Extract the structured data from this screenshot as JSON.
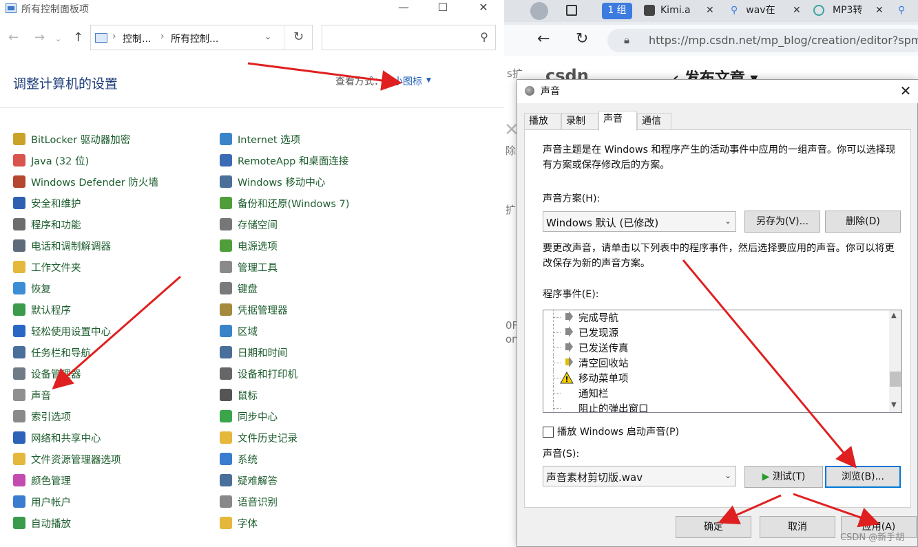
{
  "control_panel": {
    "window_title": "所有控制面板项",
    "window_buttons": [
      "—",
      "☐",
      "✕"
    ],
    "breadcrumb": [
      "控制...",
      "所有控制..."
    ],
    "search_placeholder": "",
    "heading": "调整计算机的设置",
    "view_by_label": "查看方式：",
    "view_by_value": "小图标",
    "items_left": [
      {
        "label": "BitLocker 驱动器加密",
        "icon": "bitlocker-icon",
        "color": "#c9a227"
      },
      {
        "label": "Java (32 位)",
        "icon": "java-icon",
        "color": "#d9534f"
      },
      {
        "label": "Windows Defender 防火墙",
        "icon": "firewall-icon",
        "color": "#b5462f"
      },
      {
        "label": "安全和维护",
        "icon": "flag-icon",
        "color": "#2f5fb3"
      },
      {
        "label": "程序和功能",
        "icon": "programs-icon",
        "color": "#6d6d6d"
      },
      {
        "label": "电话和调制解调器",
        "icon": "phone-icon",
        "color": "#5e6b7a"
      },
      {
        "label": "工作文件夹",
        "icon": "work-folder-icon",
        "color": "#e5b73b"
      },
      {
        "label": "恢复",
        "icon": "recovery-icon",
        "color": "#3b8ed6"
      },
      {
        "label": "默认程序",
        "icon": "default-programs-icon",
        "color": "#3a9b4c"
      },
      {
        "label": "轻松使用设置中心",
        "icon": "accessibility-icon",
        "color": "#2a67c4"
      },
      {
        "label": "任务栏和导航",
        "icon": "taskbar-icon",
        "color": "#4a6f9a"
      },
      {
        "label": "设备管理器",
        "icon": "device-manager-icon",
        "color": "#6f7b86"
      },
      {
        "label": "声音",
        "icon": "sound-icon",
        "color": "#8f8f8f"
      },
      {
        "label": "索引选项",
        "icon": "index-icon",
        "color": "#8a8a8a"
      },
      {
        "label": "网络和共享中心",
        "icon": "network-icon",
        "color": "#2c62b8"
      },
      {
        "label": "文件资源管理器选项",
        "icon": "folder-options-icon",
        "color": "#e5b73b"
      },
      {
        "label": "颜色管理",
        "icon": "color-icon",
        "color": "#c44bb0"
      },
      {
        "label": "用户帐户",
        "icon": "user-accounts-icon",
        "color": "#3a7ccf"
      },
      {
        "label": "自动播放",
        "icon": "autoplay-icon",
        "color": "#3a9b4c"
      }
    ],
    "items_right": [
      {
        "label": "Internet 选项",
        "icon": "internet-icon",
        "color": "#3a85c9"
      },
      {
        "label": "RemoteApp 和桌面连接",
        "icon": "remoteapp-icon",
        "color": "#3b6bb5"
      },
      {
        "label": "Windows 移动中心",
        "icon": "mobility-icon",
        "color": "#4a6f9a"
      },
      {
        "label": "备份和还原(Windows 7)",
        "icon": "backup-icon",
        "color": "#4f9e3a"
      },
      {
        "label": "存储空间",
        "icon": "storage-icon",
        "color": "#777777"
      },
      {
        "label": "电源选项",
        "icon": "power-icon",
        "color": "#4f9e3a"
      },
      {
        "label": "管理工具",
        "icon": "admin-tools-icon",
        "color": "#8a8a8a"
      },
      {
        "label": "键盘",
        "icon": "keyboard-icon",
        "color": "#7a7a7a"
      },
      {
        "label": "凭据管理器",
        "icon": "credential-icon",
        "color": "#a58a3e"
      },
      {
        "label": "区域",
        "icon": "region-icon",
        "color": "#3a85c9"
      },
      {
        "label": "日期和时间",
        "icon": "clock-icon",
        "color": "#4a6f9a"
      },
      {
        "label": "设备和打印机",
        "icon": "printer-icon",
        "color": "#666666"
      },
      {
        "label": "鼠标",
        "icon": "mouse-icon",
        "color": "#555555"
      },
      {
        "label": "同步中心",
        "icon": "sync-icon",
        "color": "#3aa54a"
      },
      {
        "label": "文件历史记录",
        "icon": "file-history-icon",
        "color": "#e5b73b"
      },
      {
        "label": "系统",
        "icon": "system-icon",
        "color": "#3a7ccf"
      },
      {
        "label": "疑难解答",
        "icon": "troubleshoot-icon",
        "color": "#4a6f9a"
      },
      {
        "label": "语音识别",
        "icon": "mic-icon",
        "color": "#888888"
      },
      {
        "label": "字体",
        "icon": "font-icon",
        "color": "#e5b73b"
      }
    ]
  },
  "browser": {
    "tabs": [
      "1 组",
      "Kimi.a",
      "wav在",
      "MP3转"
    ],
    "url": "https://mp.csdn.net/mp_blog/creation/editor?spm=",
    "page_logo": "csdn",
    "page_title": "发布文章",
    "side_snippets": [
      "s扩",
      "除",
      "扩",
      "0F",
      "ong"
    ]
  },
  "sound_dialog": {
    "title": "声音",
    "tabs": [
      "播放",
      "录制",
      "声音",
      "通信"
    ],
    "active_tab": 2,
    "intro": "声音主题是在 Windows 和程序产生的活动事件中应用的一组声音。你可以选择现有方案或保存修改后的方案。",
    "scheme_label": "声音方案(H):",
    "scheme_value": "Windows 默认 (已修改)",
    "save_as": "另存为(V)...",
    "delete": "删除(D)",
    "instructions": "要更改声音，请单击以下列表中的程序事件，然后选择要应用的声音。你可以将更改保存为新的声音方案。",
    "events_label": "程序事件(E):",
    "events": [
      {
        "label": "完成导航",
        "icon": "speaker"
      },
      {
        "label": "已发现源",
        "icon": "speaker"
      },
      {
        "label": "已发送传真",
        "icon": "speaker"
      },
      {
        "label": "清空回收站",
        "icon": "speaker-active"
      },
      {
        "label": "移动菜单项",
        "icon": "warning"
      },
      {
        "label": "通知栏",
        "icon": "none"
      },
      {
        "label": "阻止的弹出窗口",
        "icon": "none"
      }
    ],
    "play_startup": "播放 Windows 启动声音(P)",
    "sounds_label": "声音(S):",
    "sound_value": "声音素材剪切版.wav",
    "test": "测试(T)",
    "browse": "浏览(B)...",
    "ok": "确定",
    "cancel": "取消",
    "apply": "应用(A)"
  },
  "watermark": "CSDN @新手胡",
  "colors": {
    "annotation_arrow": "#e02020",
    "link_green": "#1d5d2e",
    "heading_blue": "#1e3e7a"
  }
}
